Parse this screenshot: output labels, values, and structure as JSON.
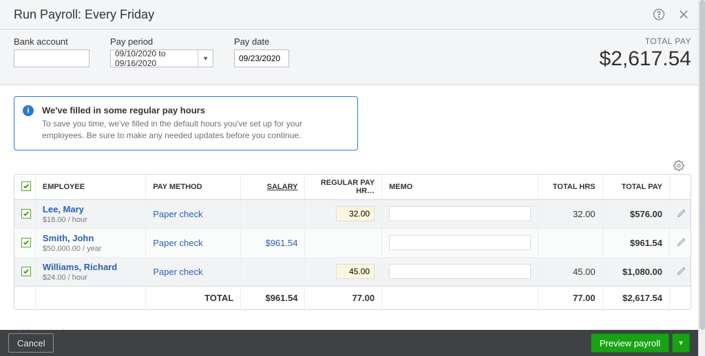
{
  "page_title": "Run Payroll: Every Friday",
  "filters": {
    "bank_account_label": "Bank account",
    "bank_account_value": "",
    "pay_period_label": "Pay period",
    "pay_period_value": "09/10/2020 to 09/16/2020",
    "pay_date_label": "Pay date",
    "pay_date_value": "09/23/2020"
  },
  "summary": {
    "total_pay_label": "TOTAL PAY",
    "total_pay_amount": "$2,617.54"
  },
  "info": {
    "title": "We've filled in some regular pay hours",
    "body": "To save you time, we've filled in the default hours you've set up for your employees. Be sure to make any needed updates before you continue."
  },
  "table": {
    "headers": {
      "employee": "EMPLOYEE",
      "pay_method": "PAY METHOD",
      "salary": "SALARY",
      "regular_hours": "REGULAR PAY HR…",
      "memo": "MEMO",
      "total_hours": "TOTAL HRS",
      "total_pay": "TOTAL PAY"
    },
    "rows": [
      {
        "name": "Lee, Mary",
        "rate": "$18.00 / hour",
        "pay_method": "Paper check",
        "salary": "",
        "regular_hours": "32.00",
        "memo": "",
        "total_hours": "32.00",
        "total_pay": "$576.00"
      },
      {
        "name": "Smith, John",
        "rate": "$50,000.00 / year",
        "pay_method": "Paper check",
        "salary": "$961.54",
        "regular_hours": "",
        "memo": "",
        "total_hours": "",
        "total_pay": "$961.54"
      },
      {
        "name": "Williams, Richard",
        "rate": "$24.00 / hour",
        "pay_method": "Paper check",
        "salary": "",
        "regular_hours": "45.00",
        "memo": "",
        "total_hours": "45.00",
        "total_pay": "$1,080.00"
      }
    ],
    "totals": {
      "label": "TOTAL",
      "salary": "$961.54",
      "regular_hours": "77.00",
      "total_hours": "77.00",
      "total_pay": "$2,617.54"
    }
  },
  "links": {
    "add_employee": "Add an employee"
  },
  "buttons": {
    "cancel": "Cancel",
    "preview": "Preview payroll"
  }
}
